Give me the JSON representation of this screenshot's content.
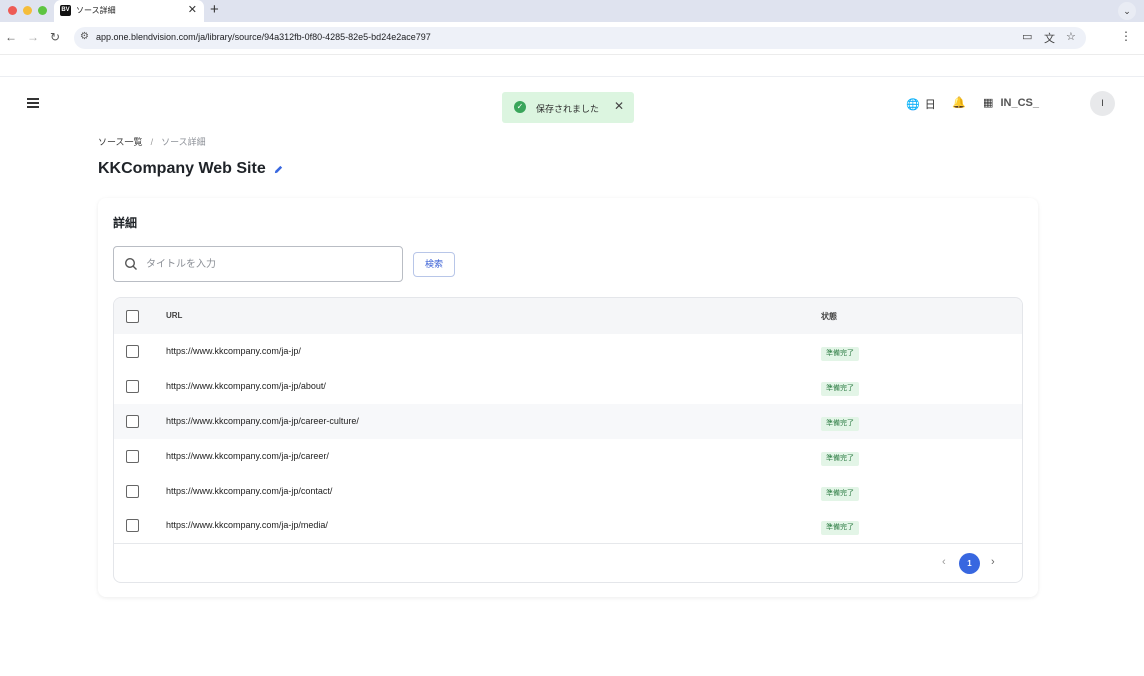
{
  "browser": {
    "tab_title": "ソース詳細",
    "tab_favicon": "BV",
    "url": "app.one.blendvision.com/ja/library/source/94a312fb-0f80-4285-82e5-bd24e2ace797"
  },
  "toast": {
    "message": "保存されました"
  },
  "header": {
    "language": "日",
    "org": "IN_CS_",
    "avatar_initial": "I"
  },
  "breadcrumb": {
    "parent": "ソース一覧",
    "separator": "/",
    "current": "ソース詳細"
  },
  "page_title": "KKCompany Web Site",
  "card": {
    "title": "詳細",
    "search_placeholder": "タイトルを入力",
    "search_button": "検索",
    "columns": {
      "url": "URL",
      "status": "状態"
    },
    "rows": [
      {
        "url": "https://www.kkcompany.com/ja-jp/",
        "status": "準備完了"
      },
      {
        "url": "https://www.kkcompany.com/ja-jp/about/",
        "status": "準備完了"
      },
      {
        "url": "https://www.kkcompany.com/ja-jp/career-culture/",
        "status": "準備完了"
      },
      {
        "url": "https://www.kkcompany.com/ja-jp/career/",
        "status": "準備完了"
      },
      {
        "url": "https://www.kkcompany.com/ja-jp/contact/",
        "status": "準備完了"
      },
      {
        "url": "https://www.kkcompany.com/ja-jp/media/",
        "status": "準備完了"
      }
    ],
    "pagination": {
      "current_page": "1"
    }
  },
  "colors": {
    "accent": "#3867e0",
    "success": "#3aa55b",
    "badge_bg": "#e3f5e7"
  }
}
